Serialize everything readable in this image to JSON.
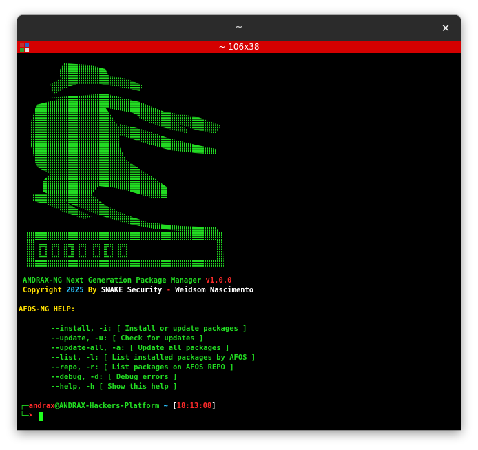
{
  "window": {
    "title": "~",
    "close_icon": "close-icon"
  },
  "tab": {
    "title": "~ 106x38",
    "icon": "terminal-tab-icon",
    "colors": [
      "#c03030",
      "#3060c0",
      "#30a030",
      "#e0e0e0"
    ]
  },
  "banner": {
    "art": "dragon-ascii-art",
    "title": "ANDRAX-NG Next Generation Package Manager",
    "version": "v1.0.0",
    "copyright_word": "Copyright",
    "year": "2025",
    "by": "By",
    "company": "SNAKE Security",
    "dash": "-",
    "author": "Weidsom Nascimento"
  },
  "help": {
    "header": "AFOS-NG HELP:",
    "options": [
      {
        "flag": "--install, -i:",
        "desc": "[ Install or update packages ]"
      },
      {
        "flag": "--update, -u:",
        "desc": "[ Check for updates ]"
      },
      {
        "flag": "--update-all, -a:",
        "desc": "[ Update all packages ]"
      },
      {
        "flag": "--list, -l:",
        "desc": "[ List installed packages by AFOS ]"
      },
      {
        "flag": "--repo, -r:",
        "desc": "[ List packages on AFOS REPO ]"
      },
      {
        "flag": "--debug, -d:",
        "desc": "[ Debug errors ]"
      },
      {
        "flag": "--help, -h",
        "desc": "[ Show this help ]"
      }
    ]
  },
  "prompt": {
    "corner_top": "┌─",
    "user": "andrax",
    "at": "@",
    "host": "ANDRAX-Hackers-Platform",
    "dir": "~",
    "lbracket": "[",
    "time": "18:13:08",
    "rbracket": "]",
    "corner_bottom": "└─",
    "arrow": "➤"
  },
  "colors": {
    "accent_green": "#22dd22",
    "tab_red": "#d40000",
    "yellow": "#ffe000",
    "cyan": "#2bc4ff",
    "red": "#ff2a2a"
  }
}
